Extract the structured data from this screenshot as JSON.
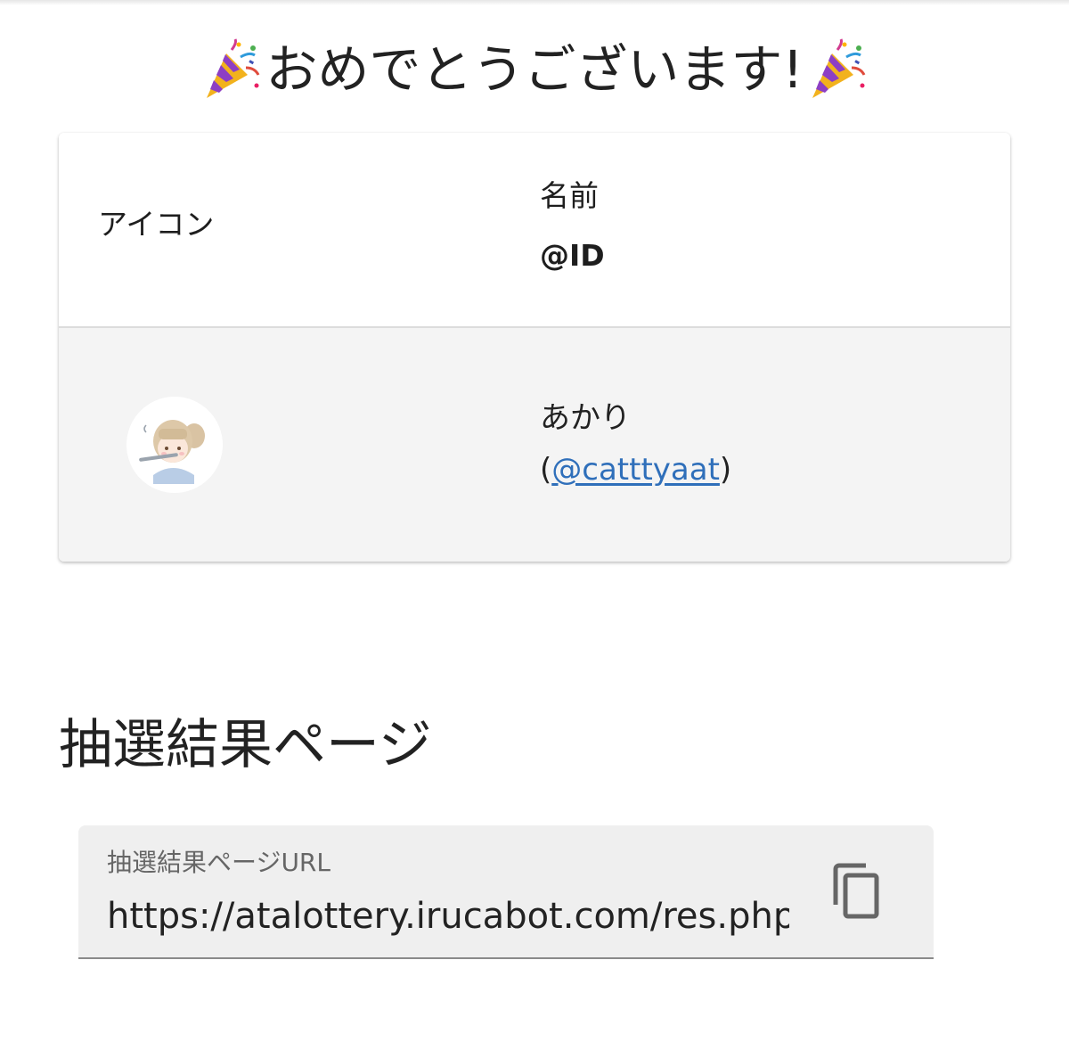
{
  "heading": {
    "title": "おめでとうございます!",
    "left_icon": "party-popper-icon",
    "right_icon": "party-popper-icon"
  },
  "winner_table": {
    "columns": {
      "icon_label": "アイコン",
      "name_label": "名前",
      "id_label": "@ID"
    },
    "rows": [
      {
        "avatar": "avatar-image",
        "name": "あかり",
        "id_prefix": "(",
        "id_handle": "@catttyaat",
        "id_suffix": ")"
      }
    ],
    "link_color": "#2f6fba"
  },
  "results_section": {
    "title": "抽選結果ページ",
    "url_field": {
      "label": "抽選結果ページURL",
      "value": "https://atalottery.irucabot.com/res.php",
      "copy_icon": "copy-icon"
    }
  }
}
